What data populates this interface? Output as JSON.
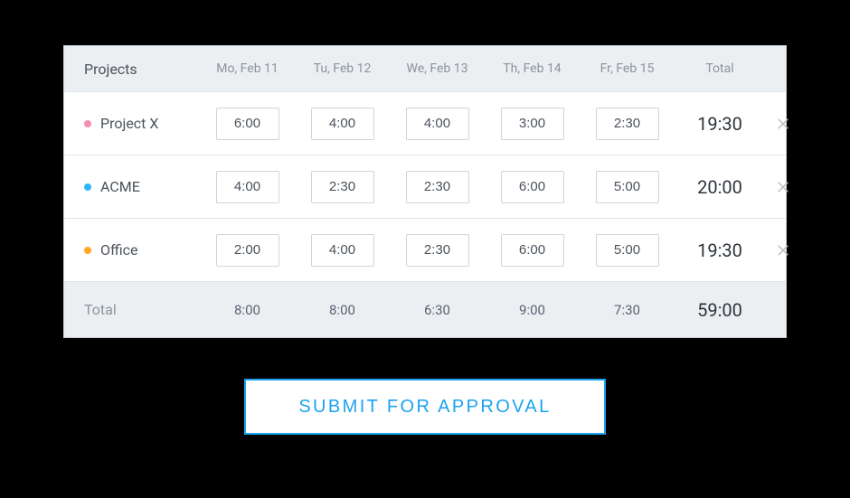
{
  "header": {
    "projects_label": "Projects",
    "days": [
      "Mo, Feb 11",
      "Tu, Feb 12",
      "We, Feb 13",
      "Th, Feb 14",
      "Fr, Feb 15"
    ],
    "total_label": "Total"
  },
  "rows": [
    {
      "name": "Project X",
      "color": "#f48fb1",
      "cells": [
        "6:00",
        "4:00",
        "4:00",
        "3:00",
        "2:30"
      ],
      "total": "19:30"
    },
    {
      "name": "ACME",
      "color": "#29b6f6",
      "cells": [
        "4:00",
        "2:30",
        "2:30",
        "6:00",
        "5:00"
      ],
      "total": "20:00"
    },
    {
      "name": "Office",
      "color": "#ffa726",
      "cells": [
        "2:00",
        "4:00",
        "2:30",
        "6:00",
        "5:00"
      ],
      "total": "19:30"
    }
  ],
  "footer": {
    "label": "Total",
    "day_totals": [
      "8:00",
      "8:00",
      "6:30",
      "9:00",
      "7:30"
    ],
    "grand_total": "59:00"
  },
  "submit_label": "SUBMIT FOR APPROVAL"
}
